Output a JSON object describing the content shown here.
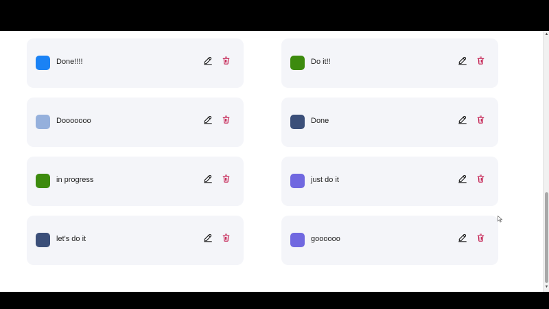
{
  "cards": [
    {
      "label": "Done!!!!",
      "color": "#1a82f5"
    },
    {
      "label": "Do it!!",
      "color": "#3d8b0e"
    },
    {
      "label": "Dooooooo",
      "color": "#95b0dc"
    },
    {
      "label": "Done",
      "color": "#3b4f79"
    },
    {
      "label": "in progress",
      "color": "#3d8b0e"
    },
    {
      "label": "just do it",
      "color": "#7068e0"
    },
    {
      "label": "let's do it",
      "color": "#3b4f79"
    },
    {
      "label": "goooooo",
      "color": "#7068e0"
    }
  ],
  "icons": {
    "edit": "pencil-icon",
    "delete": "trash-icon"
  },
  "colors": {
    "delete_icon": "#c2184b",
    "edit_icon": "#222222",
    "card_bg": "#f4f5f9"
  }
}
